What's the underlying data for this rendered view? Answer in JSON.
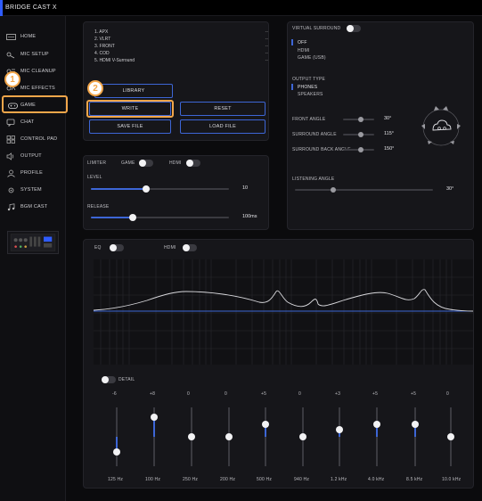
{
  "app": {
    "title": "BRIDGE CAST X"
  },
  "sidebar": {
    "items": [
      {
        "label": "HOME",
        "icon": "home-icon"
      },
      {
        "label": "MIC SETUP",
        "icon": "mic-setup-icon"
      },
      {
        "label": "MIC CLEANUP",
        "icon": "mic-cleanup-icon"
      },
      {
        "label": "MIC EFFECTS",
        "icon": "mic-effects-icon"
      },
      {
        "label": "GAME",
        "icon": "gamepad-icon"
      },
      {
        "label": "CHAT",
        "icon": "chat-icon"
      },
      {
        "label": "CONTROL PAD",
        "icon": "control-pad-icon"
      },
      {
        "label": "OUTPUT",
        "icon": "speaker-icon"
      },
      {
        "label": "PROFILE",
        "icon": "profile-icon"
      },
      {
        "label": "SYSTEM",
        "icon": "system-icon"
      },
      {
        "label": "BGM CAST",
        "icon": "bgm-cast-icon"
      }
    ],
    "active": "GAME"
  },
  "callouts": {
    "one": "1",
    "two": "2"
  },
  "presets": {
    "list": [
      {
        "name": "1. APX",
        "value": "--"
      },
      {
        "name": "2. VLRT",
        "value": "--"
      },
      {
        "name": "3. FRONT",
        "value": "--"
      },
      {
        "name": "4. COD",
        "value": "--"
      },
      {
        "name": "5. HDMI V-Surround",
        "value": "--"
      }
    ],
    "library": "LIBRARY",
    "write": "WRITE",
    "reset": "RESET",
    "save_file": "SAVE FILE",
    "load_file": "LOAD FILE"
  },
  "surround": {
    "title": "VIRTUAL SURROUND",
    "sources": [
      "OFF",
      "HDMI",
      "GAME (USB)"
    ],
    "output_type_label": "OUTPUT TYPE",
    "output_types": [
      "PHONES",
      "SPEAKERS"
    ],
    "front_angle": {
      "label": "FRONT ANGLE",
      "value": "30°"
    },
    "surround_angle": {
      "label": "SURROUND ANGLE",
      "value": "115°"
    },
    "surround_back_angle": {
      "label": "SURROUND BACK ANGLE",
      "value": "150°"
    },
    "listening_angle": {
      "label": "LISTENING ANGLE",
      "value": "30°"
    }
  },
  "limiter": {
    "title": "LIMITER",
    "game_label": "GAME",
    "hdmi_label": "HDMI",
    "level": {
      "label": "LEVEL",
      "value": "10",
      "fraction": 0.4
    },
    "release": {
      "label": "RELEASE",
      "value": "100ms",
      "fraction": 0.3
    }
  },
  "eq": {
    "title": "EQ",
    "hdmi_label": "HDMI",
    "detail_label": "DETAIL",
    "bands": [
      {
        "freq": "125 Hz",
        "gain": "-6",
        "db": -6
      },
      {
        "freq": "100 Hz",
        "gain": "+8",
        "db": 8
      },
      {
        "freq": "250 Hz",
        "gain": "0",
        "db": 0
      },
      {
        "freq": "200 Hz",
        "gain": "0",
        "db": 0
      },
      {
        "freq": "500 Hz",
        "gain": "+5",
        "db": 5
      },
      {
        "freq": "940 Hz",
        "gain": "0",
        "db": 0
      },
      {
        "freq": "1.2 kHz",
        "gain": "+3",
        "db": 3
      },
      {
        "freq": "4.0 kHz",
        "gain": "+5",
        "db": 5
      },
      {
        "freq": "8.5 kHz",
        "gain": "+5",
        "db": 5
      },
      {
        "freq": "10.0 kHz",
        "gain": "0",
        "db": 0
      }
    ]
  },
  "colors": {
    "accent": "#3d66d6",
    "callout": "#f2a64a",
    "background": "#0b0b0d",
    "panel": "#16161a"
  }
}
